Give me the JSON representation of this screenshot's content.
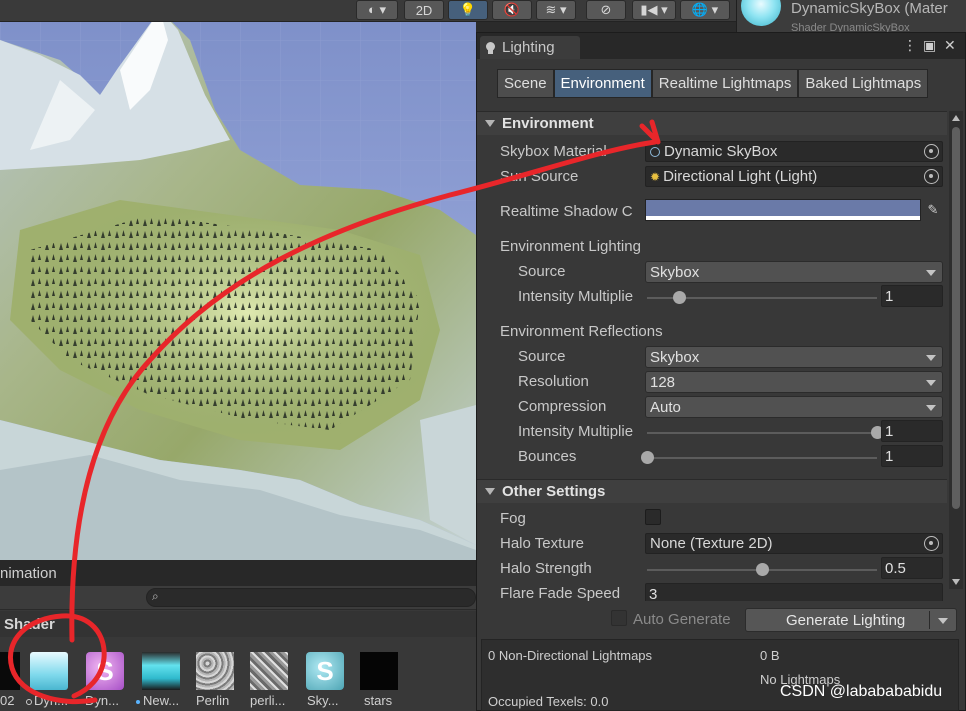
{
  "scene_toolbar": {
    "mode_2d": "2D"
  },
  "inspector": {
    "title": "DynamicSkyBox (Mater",
    "subtitle": "Shader    DynamicSkyBox"
  },
  "lighting_window": {
    "title": "Lighting",
    "tabs": [
      "Scene",
      "Environment",
      "Realtime Lightmaps",
      "Baked Lightmaps"
    ],
    "active_tab": "Environment",
    "environment_section": {
      "header": "Environment",
      "skybox_material_label": "Skybox Material",
      "skybox_material_value": "Dynamic SkyBox",
      "sun_source_label": "Sun Source",
      "sun_source_value": "Directional Light (Light)",
      "realtime_shadow_label": "Realtime Shadow C",
      "realtime_shadow_color": "#6a7aa8",
      "environment_lighting": {
        "heading": "Environment Lighting",
        "source_label": "Source",
        "source_value": "Skybox",
        "intensity_label": "Intensity Multiplie",
        "intensity_value": "1",
        "intensity_fraction": 0.14
      },
      "environment_reflections": {
        "heading": "Environment Reflections",
        "source_label": "Source",
        "source_value": "Skybox",
        "resolution_label": "Resolution",
        "resolution_value": "128",
        "compression_label": "Compression",
        "compression_value": "Auto",
        "intensity_label": "Intensity Multiplie",
        "intensity_value": "1",
        "intensity_fraction": 1.0,
        "bounces_label": "Bounces",
        "bounces_value": "1",
        "bounces_fraction": 0.0
      }
    },
    "other_settings": {
      "header": "Other Settings",
      "fog_label": "Fog",
      "fog_checked": false,
      "halo_texture_label": "Halo Texture",
      "halo_texture_value": "None (Texture 2D)",
      "halo_strength_label": "Halo Strength",
      "halo_strength_value": "0.5",
      "halo_strength_fraction": 0.5,
      "flare_fade_label": "Flare Fade Speed",
      "flare_fade_value": "3"
    },
    "footer": {
      "auto_generate_label": "Auto Generate",
      "generate_button_label": "Generate Lighting"
    },
    "stats": {
      "non_directional": "0 Non-Directional Lightmaps",
      "size": "0 B",
      "no_lightmaps": "No Lightmaps",
      "occupied_texels": "Occupied Texels: 0.0"
    }
  },
  "project_panel": {
    "tab_label": "nimation",
    "folder_label": "Shader",
    "assets": [
      {
        "label": "02",
        "kind": "dark"
      },
      {
        "label": "Dyn...",
        "kind": "skybox-material"
      },
      {
        "label": "Dyn...",
        "kind": "shader-pink"
      },
      {
        "label": "New...",
        "kind": "material-cyan"
      },
      {
        "label": "Perlin",
        "kind": "noise"
      },
      {
        "label": "perli...",
        "kind": "noise2"
      },
      {
        "label": "Sky...",
        "kind": "shader-cyan"
      },
      {
        "label": "stars",
        "kind": "dark"
      }
    ]
  },
  "watermark": "CSDN @lababababidu",
  "colors": {
    "annotation_red": "#e8262a",
    "active_tab": "#46607c"
  }
}
